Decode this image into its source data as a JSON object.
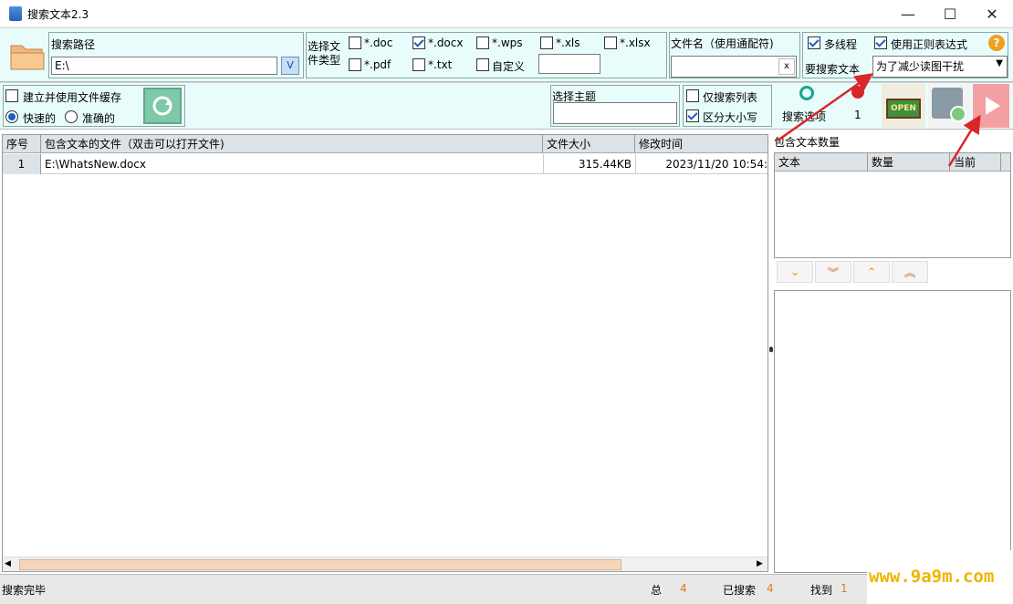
{
  "window": {
    "title": "搜索文本2.3"
  },
  "path": {
    "label": "搜索路径",
    "value": "E:\\"
  },
  "filetypes": {
    "label": "选择文件类型",
    "items": [
      {
        "label": "*.doc",
        "checked": false
      },
      {
        "label": "*.docx",
        "checked": true
      },
      {
        "label": "*.wps",
        "checked": false
      },
      {
        "label": "*.xls",
        "checked": false
      },
      {
        "label": "*.xlsx",
        "checked": false
      },
      {
        "label": "*.pdf",
        "checked": false
      },
      {
        "label": "*.txt",
        "checked": false
      },
      {
        "label": "自定义",
        "checked": false
      }
    ]
  },
  "filename": {
    "label": "文件名（使用通配符)",
    "clear": "x"
  },
  "options": {
    "multithread": "多线程",
    "regex": "使用正则表达式",
    "search_text_label": "要搜索文本",
    "search_text_value": "为了减少读图干扰",
    "help": "?"
  },
  "cache": {
    "label": "建立并使用文件缓存",
    "fast": "快速的",
    "accurate": "准确的"
  },
  "topic": {
    "label": "选择主题"
  },
  "list_options": {
    "only_list": "仅搜索列表",
    "case": "区分大小写"
  },
  "toolbar": {
    "search_options": "搜索选项",
    "count": "1",
    "open_sign": "OPEN"
  },
  "results": {
    "columns": [
      "序号",
      "包含文本的文件（双击可以打开文件)",
      "文件大小",
      "修改时间"
    ],
    "rows": [
      {
        "idx": "1",
        "file": "E:\\WhatsNew.docx",
        "size": "315.44KB",
        "mtime": "2023/11/20 10:54:"
      }
    ]
  },
  "counts": {
    "title": "包含文本数量",
    "columns": [
      "文本",
      "数量",
      "当前"
    ]
  },
  "nav": {
    "down": "⌄",
    "down2": "︾",
    "up": "⌃",
    "up2": "︽"
  },
  "status": {
    "text": "搜索完毕",
    "total_label": "总",
    "total": "4",
    "searched_label": "已搜索",
    "searched": "4",
    "found_label": "找到",
    "found": "1"
  },
  "watermark": "www.9a9m.com",
  "colors": {
    "panel": "#e8fdfb",
    "accent": "#1a5fc4",
    "orange": "#e07a1f",
    "red": "#d9262b"
  }
}
